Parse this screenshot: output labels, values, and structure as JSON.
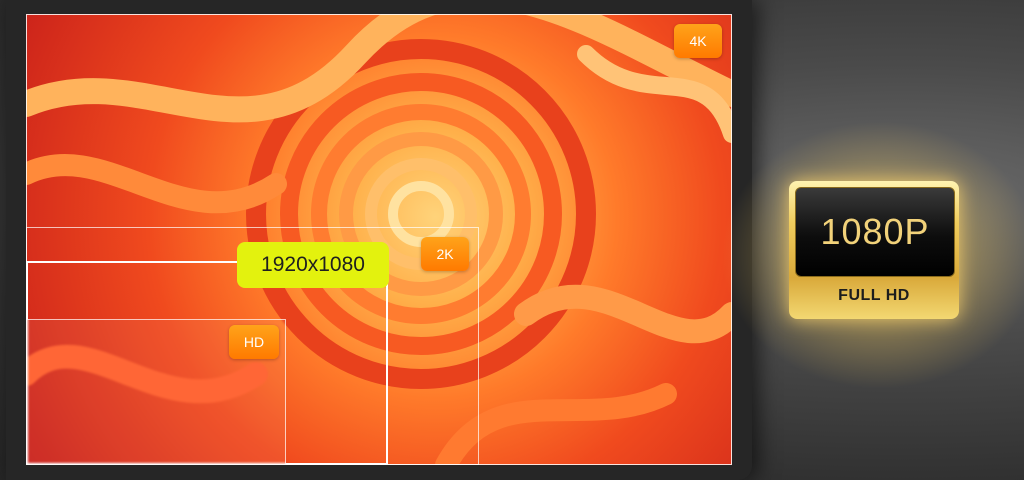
{
  "badges": {
    "uhd": "4K",
    "qhd": "2K",
    "hd": "HD"
  },
  "resolution_label": "1920x1080",
  "emblem": {
    "resolution": "1080P",
    "caption": "FULL HD"
  },
  "colors": {
    "badge_orange": "#ff8c00",
    "label_yellow": "#e3f20e",
    "gold": "#e2b64a"
  }
}
